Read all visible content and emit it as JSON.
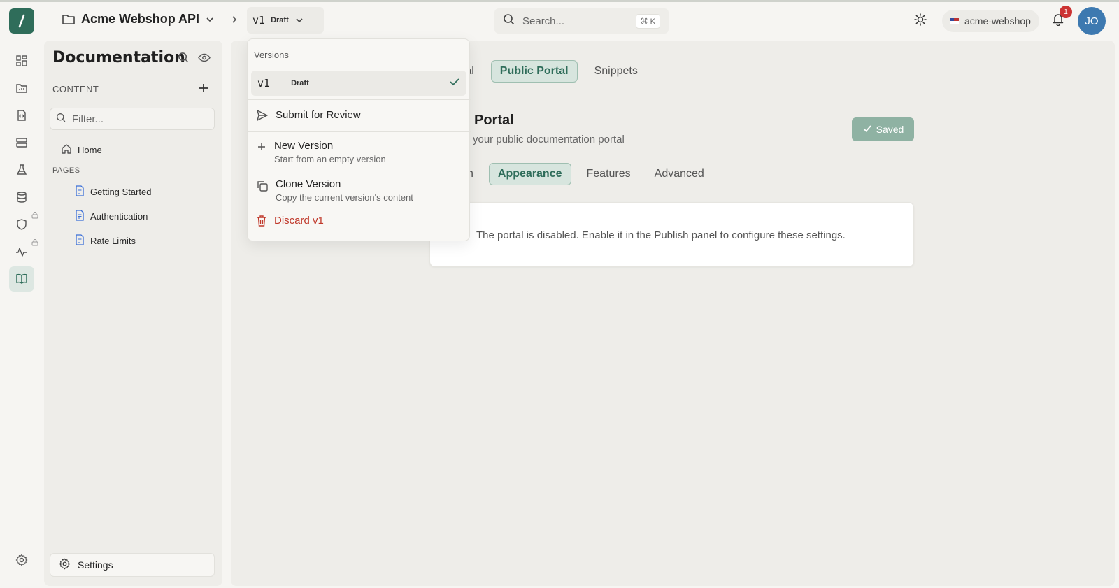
{
  "topbar": {
    "project_name": "Acme Webshop API",
    "version_label": "v1",
    "version_status": "Draft",
    "search_placeholder": "Search...",
    "search_shortcut": "⌘ K",
    "org_name": "acme-webshop",
    "notification_count": "1",
    "avatar_initials": "JO"
  },
  "rail": {
    "items": [
      "dashboard-icon",
      "folder-chart-icon",
      "api-file-icon",
      "server-icon",
      "flask-icon",
      "database-icon",
      "shield-icon",
      "activity-icon",
      "book-icon"
    ],
    "settings_icon": "gear-icon"
  },
  "leftpanel": {
    "title": "Documentation",
    "content_label": "CONTENT",
    "filter_placeholder": "Filter...",
    "home_label": "Home",
    "pages_label": "PAGES",
    "pages": [
      "Getting Started",
      "Authentication",
      "Rate Limits"
    ],
    "settings_label": "Settings"
  },
  "main": {
    "tabs": [
      "ral",
      "Public Portal",
      "Snippets"
    ],
    "active_tab": "Public Portal",
    "section_title": "Portal",
    "section_subtitle": "your public documentation portal",
    "saved_label": "Saved",
    "subtabs": [
      "sh",
      "Appearance",
      "Features",
      "Advanced"
    ],
    "active_subtab": "Appearance",
    "card_text": "The portal is disabled. Enable it in the Publish panel to configure these settings."
  },
  "dropdown": {
    "header": "Versions",
    "current_version": "v1",
    "current_status": "Draft",
    "submit_label": "Submit for Review",
    "new_version_label": "New Version",
    "new_version_desc": "Start from an empty version",
    "clone_version_label": "Clone Version",
    "clone_version_desc": "Copy the current version's content",
    "discard_label": "Discard v1"
  },
  "colors": {
    "brand": "#2f6d5a",
    "danger": "#c0392b",
    "avatar": "#3d79b0"
  }
}
